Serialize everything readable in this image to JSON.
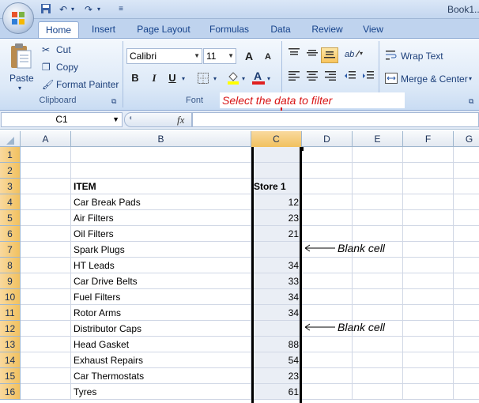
{
  "window": {
    "title": "Book1..."
  },
  "quick_access": {
    "icons": [
      "save-icon",
      "undo-icon",
      "redo-icon",
      "customize-icon"
    ]
  },
  "tabs": [
    {
      "label": "Home"
    },
    {
      "label": "Insert"
    },
    {
      "label": "Page Layout"
    },
    {
      "label": "Formulas"
    },
    {
      "label": "Data"
    },
    {
      "label": "Review"
    },
    {
      "label": "View"
    }
  ],
  "clipboard": {
    "paste": "Paste",
    "cut": "Cut",
    "copy": "Copy",
    "format_painter": "Format Painter",
    "group": "Clipboard"
  },
  "font": {
    "name": "Calibri",
    "size": "11",
    "group": "Font",
    "bold": "B",
    "italic": "I",
    "underline": "U",
    "grow": "A",
    "shrink": "A"
  },
  "alignment": {
    "wrap_text": "Wrap Text",
    "merge": "Merge & Center"
  },
  "formula_bar": {
    "name_box": "C1",
    "fx": "fx",
    "formula": ""
  },
  "annotation": {
    "select_text": "Select the data to filter",
    "blank_cell": "Blank cell"
  },
  "columns": [
    "A",
    "B",
    "C",
    "D",
    "E",
    "F",
    "G"
  ],
  "rows": [
    {
      "n": "1",
      "item": "",
      "store": ""
    },
    {
      "n": "2",
      "item": "",
      "store": ""
    },
    {
      "n": "3",
      "item": "ITEM",
      "store": "Store 1"
    },
    {
      "n": "4",
      "item": "Car Break Pads",
      "store": "12"
    },
    {
      "n": "5",
      "item": "Air Filters",
      "store": "23"
    },
    {
      "n": "6",
      "item": "Oil Filters",
      "store": "21"
    },
    {
      "n": "7",
      "item": "Spark Plugs",
      "store": ""
    },
    {
      "n": "8",
      "item": "HT Leads",
      "store": "34"
    },
    {
      "n": "9",
      "item": "Car Drive Belts",
      "store": "33"
    },
    {
      "n": "10",
      "item": "Fuel Filters",
      "store": "34"
    },
    {
      "n": "11",
      "item": "Rotor Arms",
      "store": "34"
    },
    {
      "n": "12",
      "item": "Distributor Caps",
      "store": ""
    },
    {
      "n": "13",
      "item": "Head Gasket",
      "store": "88"
    },
    {
      "n": "14",
      "item": "Exhaust Repairs",
      "store": "54"
    },
    {
      "n": "15",
      "item": "Car Thermostats",
      "store": "23"
    },
    {
      "n": "16",
      "item": "Tyres",
      "store": "61"
    }
  ],
  "colors": {
    "annotation_text": "#d81515",
    "selected_header": "#f1c15f"
  }
}
